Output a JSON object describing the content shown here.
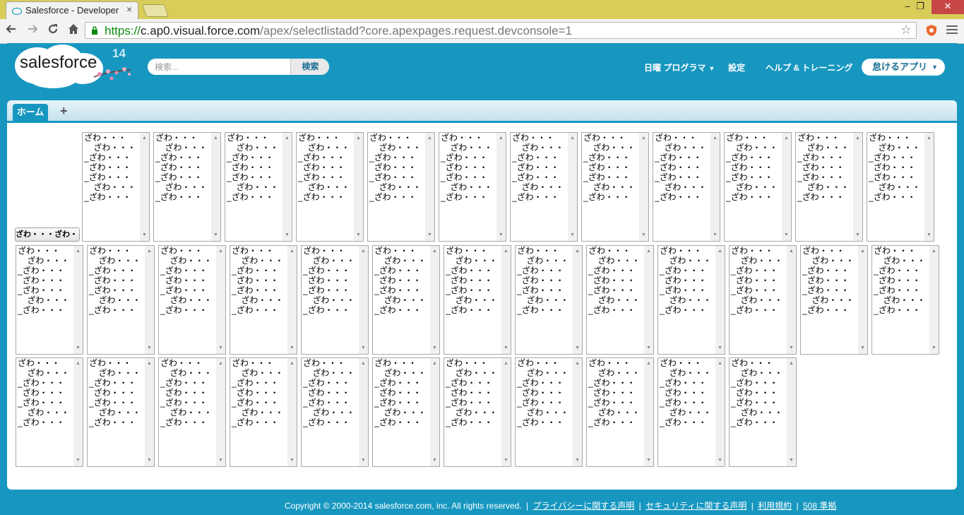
{
  "browser": {
    "tab_title": "Salesforce - Developer",
    "close_glyph": "×",
    "window_min": "–",
    "window_max": "❐",
    "window_close": "✕",
    "url": {
      "scheme": "https://",
      "host": "c.ap0.visual.force.com",
      "path": "/apex/selectlistadd?core.apexpages.request.devconsole=1"
    },
    "icons": [
      "back-arrow-icon",
      "forward-arrow-icon",
      "reload-icon",
      "home-icon",
      "lock-icon",
      "bookmark-star-icon",
      "extension-icon",
      "menu-icon"
    ]
  },
  "header": {
    "logo_text": "salesforce",
    "logo_release": "14",
    "search_placeholder": "検索...",
    "search_button": "検索",
    "user_menu": "日曜 プログラマ",
    "setup": "設定",
    "help": "ヘルプ & トレーニング",
    "app_menu": "怠けるアプリ",
    "accent_color": "#1797c0"
  },
  "tabs": {
    "home": "ホーム",
    "plus": "+"
  },
  "main": {
    "button_label": "ざわ・・・ざわ・・・",
    "listbox_options": [
      "ざわ・・・",
      "    ざわ・・・",
      "_ざわ・・・",
      "  ざわ・・・",
      "_ざわ・・・",
      "    ざわ・・・",
      "_ざわ・・・"
    ],
    "listbox_count": 36
  },
  "footer": {
    "copyright": "Copyright © 2000-2014 salesforce.com, inc. All rights reserved.",
    "links": [
      "プライバシーに関する声明",
      "セキュリティに関する声明",
      "利用規約",
      "508 準拠"
    ]
  }
}
